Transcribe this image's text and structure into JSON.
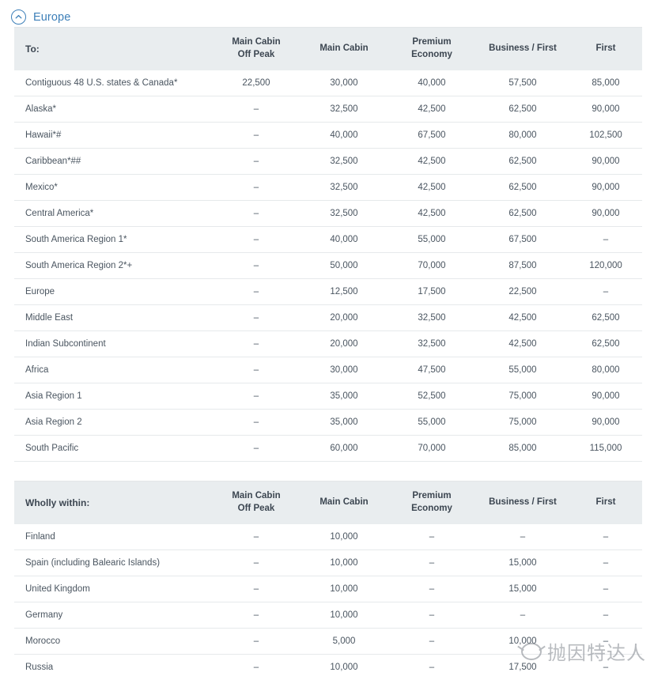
{
  "section": {
    "title": "Europe",
    "collapse_icon": "chevron-up-circle-icon",
    "accent_color": "#3d7fb8"
  },
  "tables": [
    {
      "id": "from-europe-to",
      "columns": [
        "To:",
        "Main Cabin\nOff Peak",
        "Main Cabin",
        "Premium\nEconomy",
        "Business / First",
        "First"
      ],
      "columns_display": [
        {
          "line1": "To:",
          "line2": ""
        },
        {
          "line1": "Main Cabin",
          "line2": "Off Peak"
        },
        {
          "line1": "Main Cabin",
          "line2": ""
        },
        {
          "line1": "Premium",
          "line2": "Economy"
        },
        {
          "line1": "Business / First",
          "line2": ""
        },
        {
          "line1": "First",
          "line2": ""
        }
      ],
      "rows": [
        {
          "label": "Contiguous 48 U.S. states & Canada*",
          "values": [
            "22,500",
            "30,000",
            "40,000",
            "57,500",
            "85,000"
          ]
        },
        {
          "label": "Alaska*",
          "values": [
            "–",
            "32,500",
            "42,500",
            "62,500",
            "90,000"
          ]
        },
        {
          "label": "Hawaii*#",
          "values": [
            "–",
            "40,000",
            "67,500",
            "80,000",
            "102,500"
          ]
        },
        {
          "label": "Caribbean*##",
          "values": [
            "–",
            "32,500",
            "42,500",
            "62,500",
            "90,000"
          ]
        },
        {
          "label": "Mexico*",
          "values": [
            "–",
            "32,500",
            "42,500",
            "62,500",
            "90,000"
          ]
        },
        {
          "label": "Central America*",
          "values": [
            "–",
            "32,500",
            "42,500",
            "62,500",
            "90,000"
          ]
        },
        {
          "label": "South America Region 1*",
          "values": [
            "–",
            "40,000",
            "55,000",
            "67,500",
            "–"
          ]
        },
        {
          "label": "South America Region 2*+",
          "values": [
            "–",
            "50,000",
            "70,000",
            "87,500",
            "120,000"
          ]
        },
        {
          "label": "Europe",
          "values": [
            "–",
            "12,500",
            "17,500",
            "22,500",
            "–"
          ]
        },
        {
          "label": "Middle East",
          "values": [
            "–",
            "20,000",
            "32,500",
            "42,500",
            "62,500"
          ]
        },
        {
          "label": "Indian Subcontinent",
          "values": [
            "–",
            "20,000",
            "32,500",
            "42,500",
            "62,500"
          ]
        },
        {
          "label": "Africa",
          "values": [
            "–",
            "30,000",
            "47,500",
            "55,000",
            "80,000"
          ]
        },
        {
          "label": "Asia Region 1",
          "values": [
            "–",
            "35,000",
            "52,500",
            "75,000",
            "90,000"
          ]
        },
        {
          "label": "Asia Region 2",
          "values": [
            "–",
            "35,000",
            "55,000",
            "75,000",
            "90,000"
          ]
        },
        {
          "label": "South Pacific",
          "values": [
            "–",
            "60,000",
            "70,000",
            "85,000",
            "115,000"
          ]
        }
      ]
    },
    {
      "id": "wholly-within",
      "columns": [
        "Wholly within:",
        "Main Cabin\nOff Peak",
        "Main Cabin",
        "Premium\nEconomy",
        "Business / First",
        "First"
      ],
      "columns_display": [
        {
          "line1": "Wholly within:",
          "line2": ""
        },
        {
          "line1": "Main Cabin",
          "line2": "Off Peak"
        },
        {
          "line1": "Main Cabin",
          "line2": ""
        },
        {
          "line1": "Premium",
          "line2": "Economy"
        },
        {
          "line1": "Business / First",
          "line2": ""
        },
        {
          "line1": "First",
          "line2": ""
        }
      ],
      "rows": [
        {
          "label": "Finland",
          "values": [
            "–",
            "10,000",
            "–",
            "–",
            "–"
          ]
        },
        {
          "label": "Spain (including Balearic Islands)",
          "values": [
            "–",
            "10,000",
            "–",
            "15,000",
            "–"
          ]
        },
        {
          "label": "United Kingdom",
          "values": [
            "–",
            "10,000",
            "–",
            "15,000",
            "–"
          ]
        },
        {
          "label": "Germany",
          "values": [
            "–",
            "10,000",
            "–",
            "–",
            "–"
          ]
        },
        {
          "label": "Morocco",
          "values": [
            "–",
            "5,000",
            "–",
            "10,000",
            "–"
          ]
        },
        {
          "label": "Russia",
          "values": [
            "–",
            "10,000",
            "–",
            "17,500",
            "–"
          ]
        }
      ]
    }
  ],
  "watermark": {
    "text": "抛因特达人",
    "logo": "circle-logo-icon"
  }
}
